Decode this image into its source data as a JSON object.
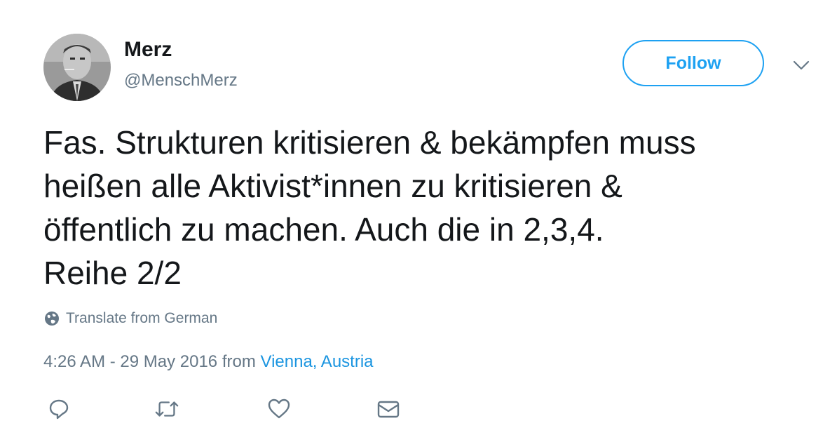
{
  "user": {
    "display_name": "Merz",
    "handle": "@MenschMerz",
    "avatar": "profile-photo"
  },
  "follow_button": {
    "label": "Follow"
  },
  "menu": {
    "icon": "chevron-down-icon"
  },
  "tweet": {
    "text": "Fas. Strukturen kritisieren & bekämpfen muss\nheißen alle Aktivist*innen zu kritisieren &\nöffentlich zu machen. Auch die in 2,3,4.\nReihe 2/2"
  },
  "translate": {
    "label": "Translate from German",
    "icon": "globe-icon"
  },
  "meta": {
    "timestamp": "4:26 AM - 29 May 2016",
    "from_label": "from",
    "location": "Vienna, Austria"
  },
  "actions": [
    {
      "name": "reply",
      "icon": "reply-icon"
    },
    {
      "name": "retweet",
      "icon": "retweet-icon"
    },
    {
      "name": "like",
      "icon": "heart-icon"
    },
    {
      "name": "message",
      "icon": "envelope-icon"
    }
  ],
  "colors": {
    "accent": "#1da1f2",
    "link": "#1b95e0",
    "muted": "#657786",
    "text": "#14171a"
  }
}
